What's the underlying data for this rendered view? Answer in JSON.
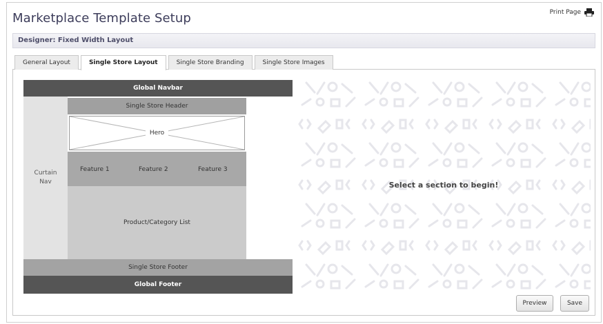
{
  "page": {
    "title": "Marketplace Template Setup",
    "print_label": "Print Page",
    "print_icon": "printer-icon"
  },
  "designer": {
    "label": "Designer: Fixed Width Layout"
  },
  "tabs": [
    {
      "label": "General Layout",
      "active": false
    },
    {
      "label": "Single Store Layout",
      "active": true
    },
    {
      "label": "Single Store Branding",
      "active": false
    },
    {
      "label": "Single Store Images",
      "active": false
    }
  ],
  "layout": {
    "global_navbar": "Global Navbar",
    "curtain_nav": "Curtain\nNav",
    "store_header": "Single Store Header",
    "hero": "Hero",
    "features": [
      "Feature 1",
      "Feature 2",
      "Feature 3"
    ],
    "product_list": "Product/Category List",
    "store_footer": "Single Store Footer",
    "global_footer": "Global Footer"
  },
  "editor": {
    "prompt": "Select a section to begin!"
  },
  "buttons": {
    "preview": "Preview",
    "save": "Save"
  },
  "colors": {
    "title": "#3c3c5a",
    "navbar": "#555555",
    "pattern": "#ececf0"
  }
}
